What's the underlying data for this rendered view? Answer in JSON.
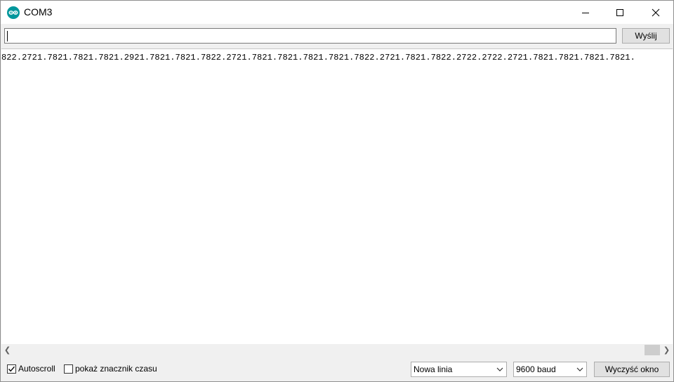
{
  "window": {
    "title": "COM3",
    "icon": "arduino-logo-icon",
    "controls": [
      "minimize-icon",
      "maximize-icon",
      "close-icon"
    ]
  },
  "send": {
    "input_value": "",
    "button_label": "Wyślij"
  },
  "output": {
    "text": "822.2721.7821.7821.7821.2921.7821.7821.7822.2721.7821.7821.7821.7821.7822.2721.7821.7822.2722.2722.2721.7821.7821.7821.7821."
  },
  "bottom": {
    "autoscroll_label": "Autoscroll",
    "autoscroll_checked": true,
    "timestamp_label": "pokaż znacznik czasu",
    "timestamp_checked": false,
    "line_ending": "Nowa linia",
    "baud": "9600 baud",
    "clear_label": "Wyczyść okno"
  },
  "colors": {
    "accent": "#00979c",
    "chrome": "#f0f0f0",
    "button": "#e1e1e1"
  }
}
